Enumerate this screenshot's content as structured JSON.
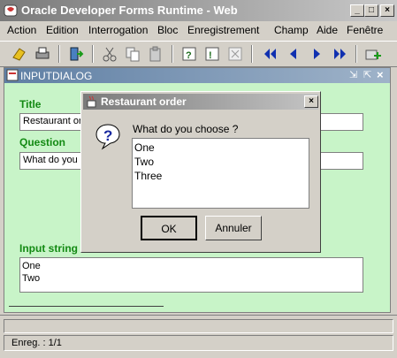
{
  "window": {
    "title": "Oracle Developer Forms Runtime - Web"
  },
  "menu": [
    "Action",
    "Edition",
    "Interrogation",
    "Bloc",
    "Enregistrement",
    "Champ",
    "Aide",
    "Fenêtre"
  ],
  "inner_window": {
    "title": "INPUTDIALOG",
    "title_label": "Title",
    "title_value": "Restaurant or",
    "question_label": "Question",
    "question_value": "What do you",
    "input_label": "Input string",
    "input_lines": [
      "One",
      "Two"
    ]
  },
  "dialog": {
    "title": "Restaurant order",
    "question": "What do you choose ?",
    "options": [
      "One",
      "Two",
      "Three"
    ],
    "ok_label": "OK",
    "cancel_label": "Annuler"
  },
  "status": {
    "record": "Enreg. : 1/1"
  },
  "colors": {
    "field_label": "#138a13",
    "form_background": "#c8f4c8"
  }
}
